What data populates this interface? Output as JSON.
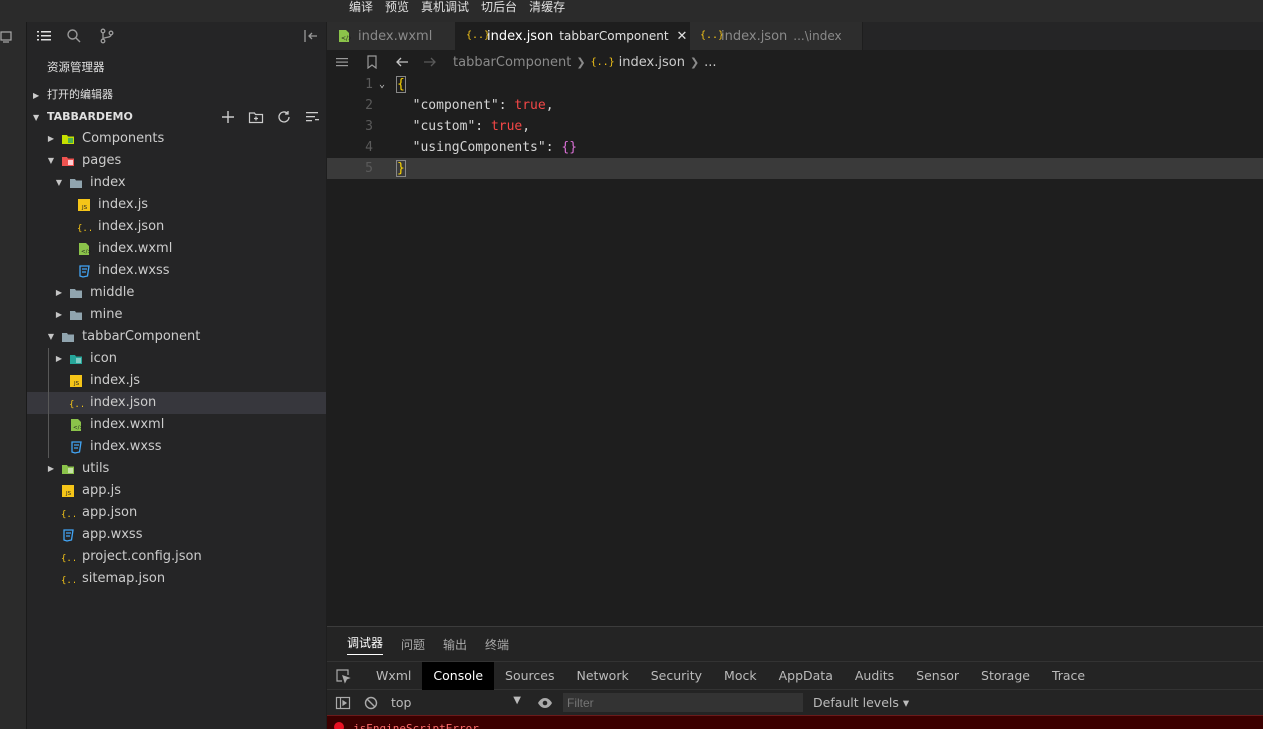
{
  "toolbar": {
    "items": [
      "编译",
      "预览",
      "真机调试",
      "切后台",
      "清缓存"
    ]
  },
  "sidebar": {
    "title": "资源管理器",
    "open_editors": "打开的编辑器",
    "project": "TABBARDEMO",
    "tree": [
      {
        "label": "Components",
        "type": "folder-comp",
        "depth": 0,
        "arrow": "closed"
      },
      {
        "label": "pages",
        "type": "folder-pages",
        "depth": 0,
        "arrow": "open"
      },
      {
        "label": "index",
        "type": "folder-open",
        "depth": 1,
        "arrow": "open"
      },
      {
        "label": "index.js",
        "type": "js",
        "depth": 2
      },
      {
        "label": "index.json",
        "type": "json",
        "depth": 2
      },
      {
        "label": "index.wxml",
        "type": "wxml",
        "depth": 2
      },
      {
        "label": "index.wxss",
        "type": "wxss",
        "depth": 2
      },
      {
        "label": "middle",
        "type": "folder",
        "depth": 1,
        "arrow": "closed"
      },
      {
        "label": "mine",
        "type": "folder",
        "depth": 1,
        "arrow": "closed"
      },
      {
        "label": "tabbarComponent",
        "type": "folder-open",
        "depth": 0,
        "arrow": "open"
      },
      {
        "label": "icon",
        "type": "folder-img",
        "depth": 1,
        "arrow": "closed"
      },
      {
        "label": "index.js",
        "type": "js",
        "depth": 1
      },
      {
        "label": "index.json",
        "type": "json",
        "depth": 1,
        "selected": true
      },
      {
        "label": "index.wxml",
        "type": "wxml",
        "depth": 1
      },
      {
        "label": "index.wxss",
        "type": "wxss",
        "depth": 1
      },
      {
        "label": "utils",
        "type": "folder-utils",
        "depth": 0,
        "arrow": "closed"
      },
      {
        "label": "app.js",
        "type": "js",
        "depth": 0
      },
      {
        "label": "app.json",
        "type": "json",
        "depth": 0
      },
      {
        "label": "app.wxss",
        "type": "wxss",
        "depth": 0
      },
      {
        "label": "project.config.json",
        "type": "json",
        "depth": 0
      },
      {
        "label": "sitemap.json",
        "type": "json",
        "depth": 0
      }
    ]
  },
  "tabs": [
    {
      "name": "index.wxml",
      "desc": "",
      "icon": "wxml",
      "active": false
    },
    {
      "name": "index.json",
      "desc": "tabbarComponent",
      "icon": "json",
      "active": true,
      "close": "✕"
    },
    {
      "name": "index.json",
      "desc": "...\\index",
      "icon": "json",
      "active": false
    }
  ],
  "breadcrumb": {
    "folder": "tabbarComponent",
    "file": "index.json",
    "more": "..."
  },
  "editor": {
    "line_numbers": [
      "1",
      "2",
      "3",
      "4",
      "5"
    ],
    "lines": {
      "l1": "{",
      "l2_key": "\"component\"",
      "l2_val": "true",
      "l3_key": "\"custom\"",
      "l3_val": "true",
      "l4_key": "\"usingComponents\"",
      "l4_val": "{}",
      "l5": "}"
    }
  },
  "devtools": {
    "tabs": [
      "调试器",
      "问题",
      "输出",
      "终端"
    ],
    "active_tab": "调试器",
    "panels": [
      "Wxml",
      "Console",
      "Sources",
      "Network",
      "Security",
      "Mock",
      "AppData",
      "Audits",
      "Sensor",
      "Storage",
      "Trace"
    ],
    "active_panel": "Console",
    "context": "top",
    "filter_placeholder": "Filter",
    "levels": "Default levels ▾",
    "error_text": "jsEngineScriptError"
  },
  "colors": {
    "js": "#f5c518",
    "json": "#f5c518",
    "wxml": "#8bc34a",
    "wxss": "#42a5f5",
    "folder": "#90a4ae",
    "pages_folder": "#ef5350",
    "comp_folder": "#c6e000"
  }
}
